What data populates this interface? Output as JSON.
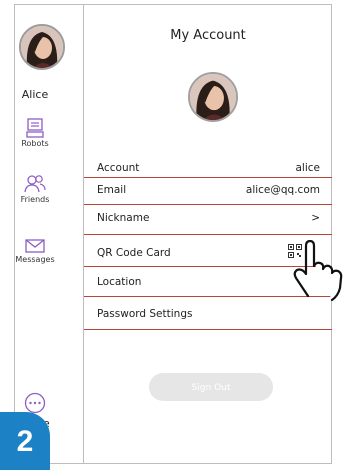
{
  "sidebar": {
    "user_name": "Alice",
    "items": [
      {
        "label": "Robots",
        "icon": "robot-icon"
      },
      {
        "label": "Friends",
        "icon": "friends-icon"
      },
      {
        "label": "Messages",
        "icon": "envelope-icon"
      }
    ],
    "more_label": "ore",
    "more_icon": "more-dots-icon"
  },
  "main": {
    "title": "My Account",
    "rows": [
      {
        "label": "Account",
        "value": "alice"
      },
      {
        "label": "Email",
        "value": "alice@qq.com"
      },
      {
        "label": "Nickname",
        "value": ">"
      },
      {
        "label": "QR Code Card",
        "value_icon": "qr-code-icon"
      },
      {
        "label": "Location",
        "value": ""
      },
      {
        "label": "Password Settings",
        "value": ""
      }
    ],
    "sign_out_label": "Sign Out"
  },
  "step_number": "2",
  "colors": {
    "separator": "#b5473a",
    "accent_purple": "#8e5cc7",
    "step_badge": "#1d81c6"
  }
}
